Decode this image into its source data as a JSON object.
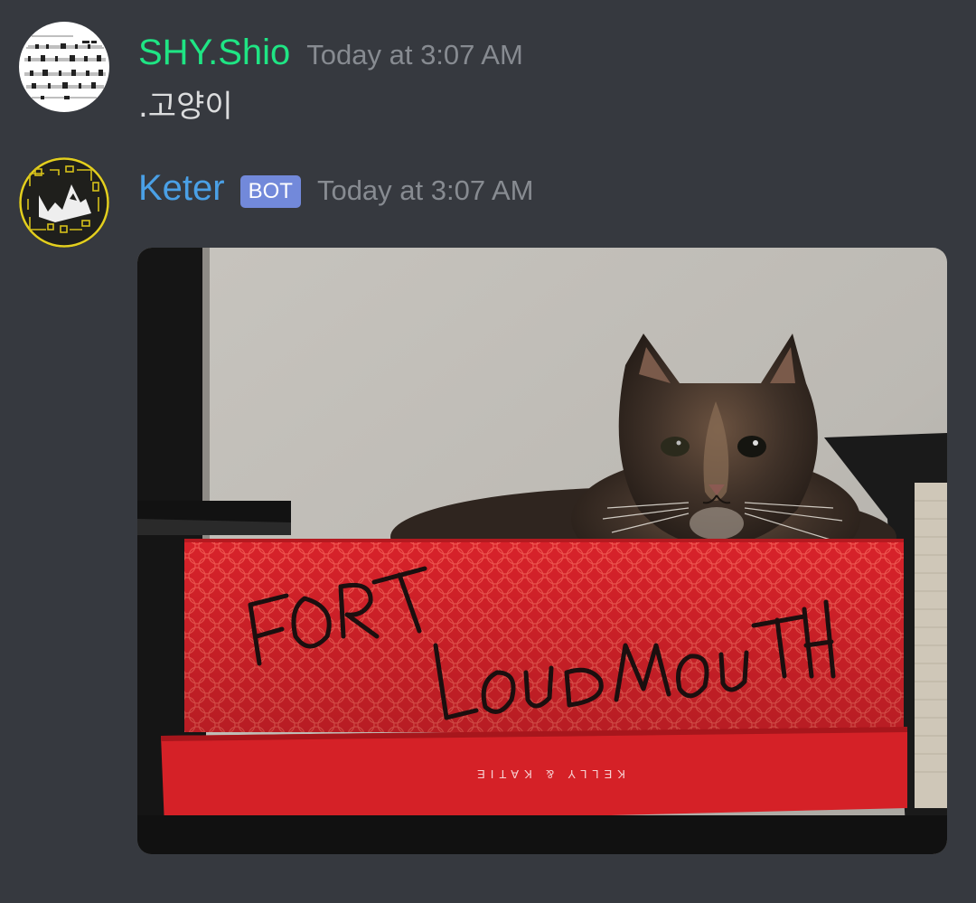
{
  "messages": [
    {
      "username": "SHY.Shio",
      "username_color": "#1fe584",
      "timestamp": "Today at 3:07 AM",
      "content": ".고양이",
      "avatar_icon": "sheet-music-avatar"
    },
    {
      "username": "Keter",
      "username_color": "#4aa0e6",
      "is_bot": true,
      "bot_label": "BOT",
      "timestamp": "Today at 3:07 AM",
      "avatar_icon": "keter-logo-avatar",
      "attachment": {
        "type": "image",
        "subject": "cat-in-red-box-photo",
        "box_writing": "FORT LOUDMOUTH",
        "box_brand": "KELLY & KATIE"
      }
    }
  ],
  "colors": {
    "background": "#36393f",
    "timestamp": "#878b91",
    "bot_tag": "#7289da",
    "text": "#dcddde"
  }
}
